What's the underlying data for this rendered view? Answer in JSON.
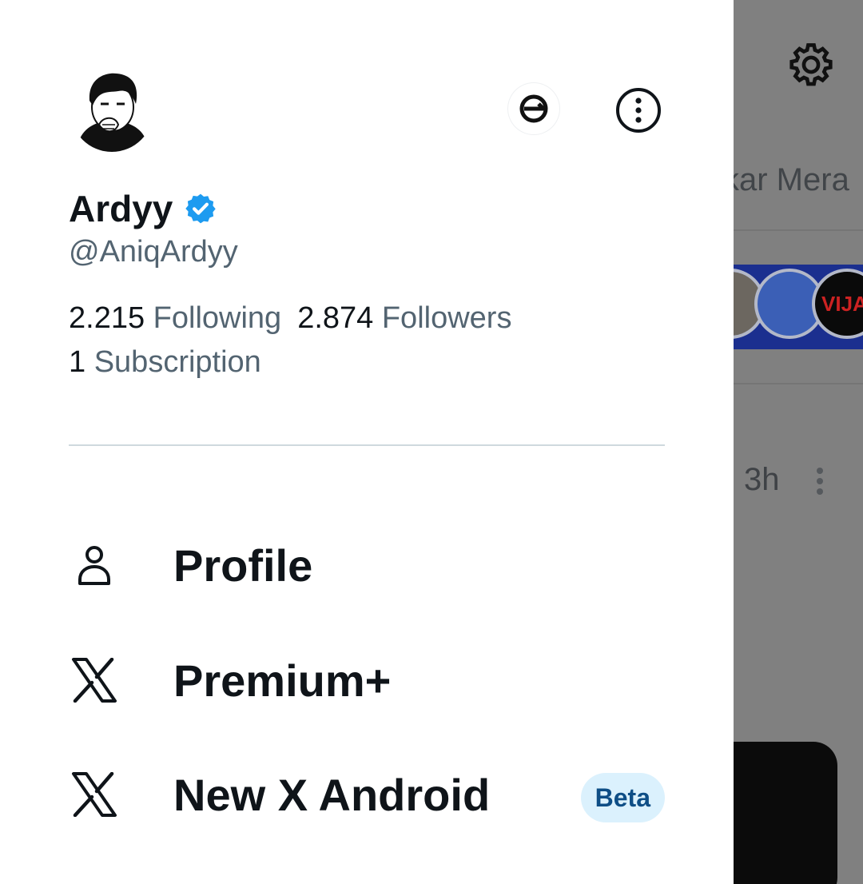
{
  "background": {
    "tab_text": "kar Mera",
    "circle_label": "VIJAY",
    "post_time": "3h"
  },
  "drawer": {
    "display_name": "Ardyy",
    "handle": "@AniqArdyy",
    "stats": {
      "following_count": "2.215",
      "following_label": "Following",
      "followers_count": "2.874",
      "followers_label": "Followers",
      "subscription_count": "1",
      "subscription_label": "Subscription"
    },
    "menu": {
      "profile_label": "Profile",
      "premium_label": "Premium+",
      "android_label": "New X Android",
      "android_badge": "Beta"
    }
  },
  "colors": {
    "verified": "#1d9bf0",
    "text_primary": "#0f1419",
    "text_secondary": "#536471",
    "beta_bg": "#dbf1fd",
    "overlay": "#808080"
  },
  "icons": [
    "settings-gear-icon",
    "brand-e-icon",
    "more-options-icon",
    "verified-badge-icon",
    "person-icon",
    "x-logo-icon"
  ]
}
